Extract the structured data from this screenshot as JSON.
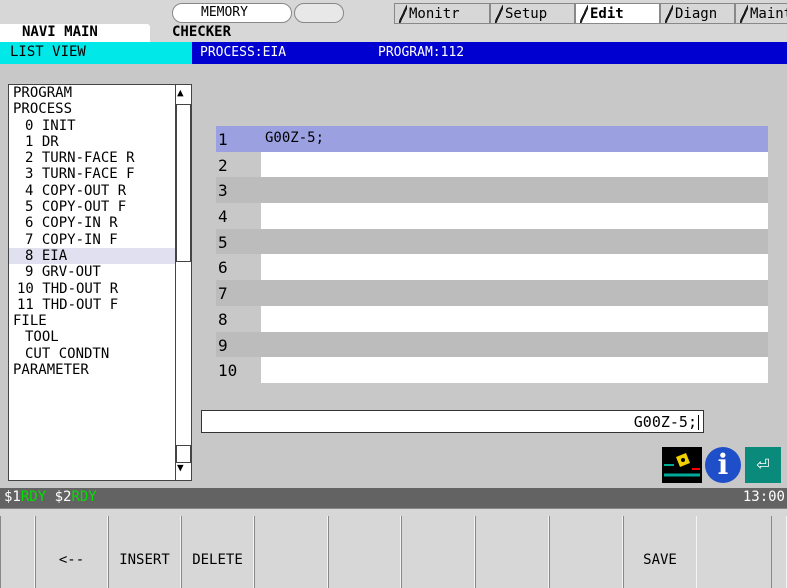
{
  "header": {
    "memory_label": "MEMORY",
    "tabs": [
      "Monitr",
      "Setup",
      "Edit",
      "Diagn",
      "Mainte"
    ]
  },
  "subtabs": [
    "NAVI MAIN",
    "CHECKER"
  ],
  "list_view_title": "LIST VIEW",
  "process_label": "PROCESS:EIA",
  "program_label": "PROGRAM:112",
  "tree": [
    {
      "label": "PROGRAM",
      "level": 0
    },
    {
      "label": "PROCESS",
      "level": 0
    },
    {
      "label": "0 INIT",
      "level": 1
    },
    {
      "label": "1 DR",
      "level": 1
    },
    {
      "label": "2 TURN-FACE R",
      "level": 1
    },
    {
      "label": "3 TURN-FACE F",
      "level": 1
    },
    {
      "label": "4 COPY-OUT R",
      "level": 1
    },
    {
      "label": "5 COPY-OUT F",
      "level": 1
    },
    {
      "label": "6 COPY-IN R",
      "level": 1
    },
    {
      "label": "7 COPY-IN F",
      "level": 1
    },
    {
      "label": "8 EIA",
      "level": 1,
      "selected": true
    },
    {
      "label": "9 GRV-OUT",
      "level": 1
    },
    {
      "label": "10 THD-OUT R",
      "level": 2
    },
    {
      "label": "11 THD-OUT F",
      "level": 2
    },
    {
      "label": "FILE",
      "level": 0
    },
    {
      "label": "TOOL",
      "level": 1
    },
    {
      "label": "CUT CONDTN",
      "level": 1
    },
    {
      "label": "PARAMETER",
      "level": 0
    }
  ],
  "program_lines": [
    {
      "num": "1",
      "text": "G00Z-5;"
    },
    {
      "num": "2",
      "text": ""
    },
    {
      "num": "3",
      "text": ""
    },
    {
      "num": "4",
      "text": ""
    },
    {
      "num": "5",
      "text": ""
    },
    {
      "num": "6",
      "text": ""
    },
    {
      "num": "7",
      "text": ""
    },
    {
      "num": "8",
      "text": ""
    },
    {
      "num": "9",
      "text": ""
    },
    {
      "num": "10",
      "text": ""
    }
  ],
  "command_input": "G00Z-5;",
  "status": {
    "s1": "$1",
    "s1_state": "RDY",
    "s2": "$2",
    "s2_state": "RDY",
    "clock": "13:00"
  },
  "function_keys": [
    "",
    "<--",
    "INSERT",
    "DELETE",
    "",
    "",
    "",
    "",
    "",
    "SAVE",
    ""
  ],
  "icons": [
    "camera-icon",
    "info-icon",
    "enter-icon"
  ]
}
